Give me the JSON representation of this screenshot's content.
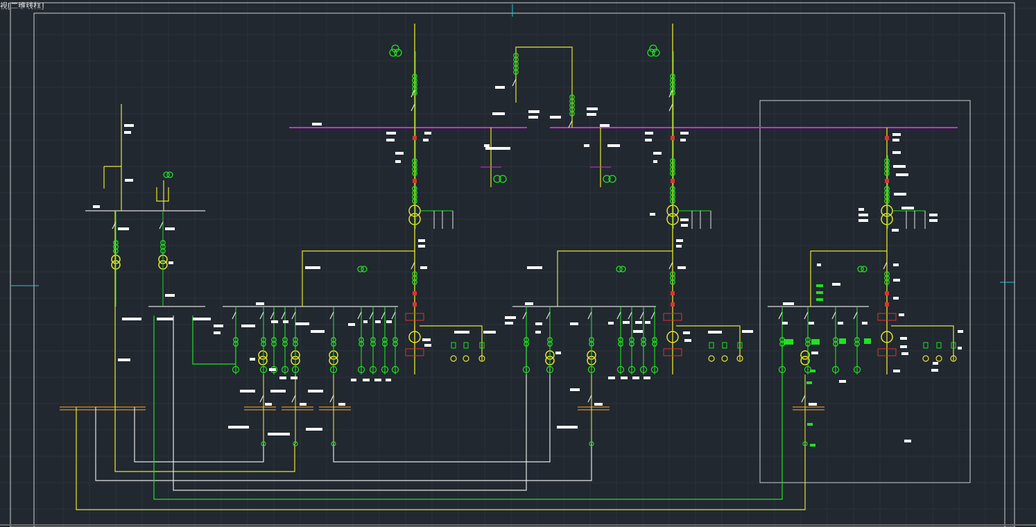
{
  "viewport": {
    "label": "视[二维线框]",
    "background": "#212830"
  },
  "colors": {
    "grid": "#2c3540",
    "frame": "#d6d6d6",
    "bus_main": "#e020e0",
    "wire_yellow": "#e6e62a",
    "wire_green": "#22e022",
    "wire_white": "#e6e6e6",
    "device_red": "#e23030",
    "device_orange": "#e08a20",
    "label_white": "#ffffff",
    "crosshair": "#2ac4d6"
  }
}
